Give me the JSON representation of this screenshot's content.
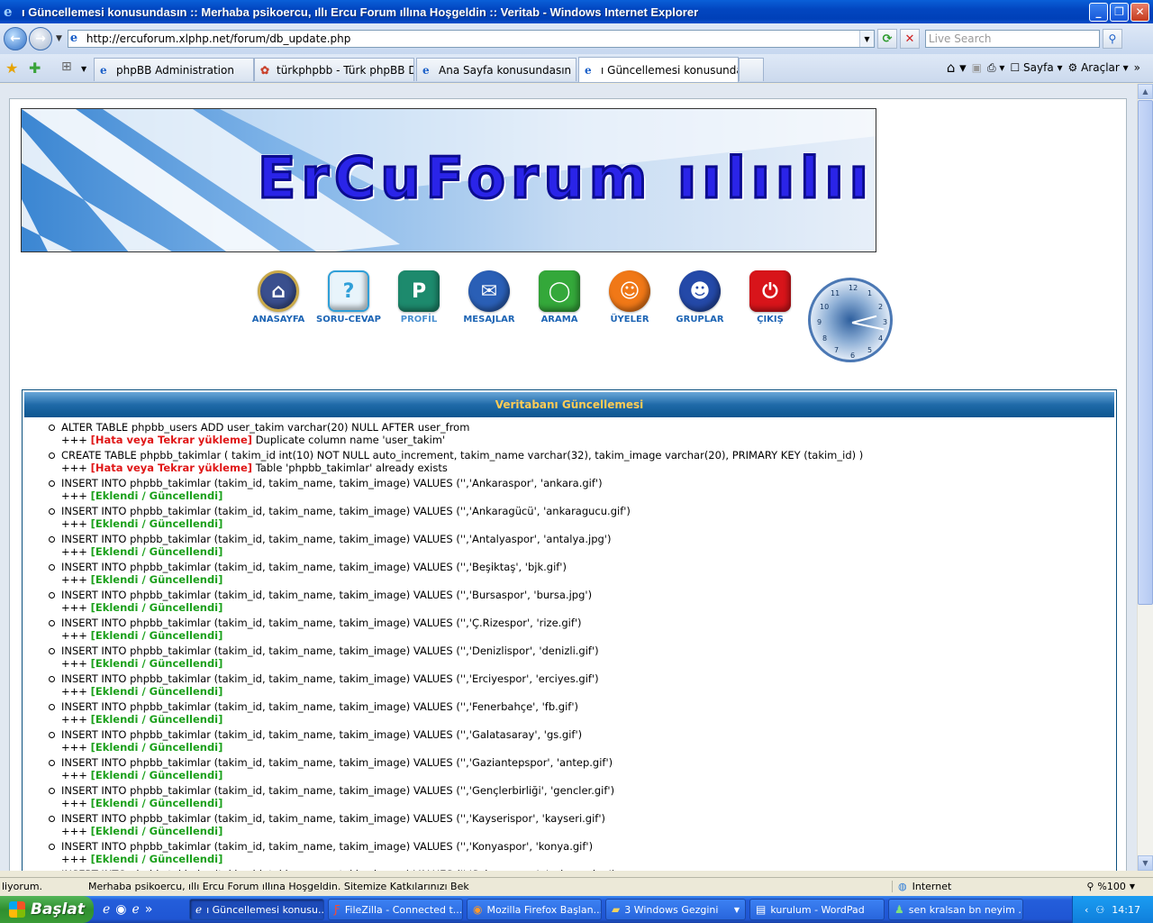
{
  "window": {
    "title": "ı Güncellemesi konusundasın :: Merhaba psikoercu, ıllı Ercu Forum ıllına Hoşgeldin :: Veritab - Windows Internet Explorer"
  },
  "address": {
    "url": "http://ercuforum.xlphp.net/forum/db_update.php",
    "search_placeholder": "Live Search"
  },
  "tabs": [
    {
      "label": "phpBB Administration",
      "active": false
    },
    {
      "label": "türkphpbb - Türk phpBB Dest...",
      "active": false
    },
    {
      "label": "Ana Sayfa konusundasın :: ...",
      "active": false
    },
    {
      "label": "ı Güncellemesi konusunda...",
      "active": true
    }
  ],
  "commandbar": {
    "page_label": "Sayfa",
    "tools_label": "Araçlar"
  },
  "banner": {
    "logo_text": "ErCuForum ıılıılıı"
  },
  "nav": [
    {
      "label": "ANASAYFA",
      "icon": "home-icon",
      "color": "#3a4f8e",
      "glyph": "⌂"
    },
    {
      "label": "SORU-CEVAP",
      "icon": "help-icon",
      "color": "#2f9fd8",
      "glyph": "?"
    },
    {
      "label": "PROFİL",
      "icon": "profile-icon",
      "color": "#1d8a6d",
      "glyph": "P"
    },
    {
      "label": "MESAJLAR",
      "icon": "messages-icon",
      "color": "#2a5fb6",
      "glyph": "✉"
    },
    {
      "label": "ARAMA",
      "icon": "search-icon",
      "color": "#34a83a",
      "glyph": "◯"
    },
    {
      "label": "ÜYELER",
      "icon": "members-icon",
      "color": "#f07817",
      "glyph": "☺"
    },
    {
      "label": "GRUPLAR",
      "icon": "groups-icon",
      "color": "#2449a8",
      "glyph": "☻"
    },
    {
      "label": "ÇIKIŞ",
      "icon": "logout-icon",
      "color": "#d8141a",
      "glyph": "⏻"
    }
  ],
  "clock": {
    "numbers": [
      "12",
      "1",
      "2",
      "3",
      "4",
      "5",
      "6",
      "7",
      "8",
      "9",
      "10",
      "11"
    ]
  },
  "panel": {
    "title": "Veritabanı Güncellemesi",
    "entries": [
      {
        "query": "ALTER TABLE phpbb_users ADD user_takim varchar(20) NULL AFTER user_from",
        "status": "[Hata veya Tekrar yükleme]",
        "type": "err",
        "detail": "Duplicate column name 'user_takim'"
      },
      {
        "query": "CREATE TABLE phpbb_takimlar ( takim_id int(10) NOT NULL auto_increment, takim_name varchar(32), takim_image varchar(20), PRIMARY KEY (takim_id) )",
        "status": "[Hata veya Tekrar yükleme]",
        "type": "err",
        "detail": "Table 'phpbb_takimlar' already exists"
      },
      {
        "query": "INSERT INTO phpbb_takimlar (takim_id, takim_name, takim_image) VALUES ('','Ankaraspor', 'ankara.gif')",
        "status": "[Eklendi / Güncellendi]",
        "type": "ok",
        "detail": ""
      },
      {
        "query": "INSERT INTO phpbb_takimlar (takim_id, takim_name, takim_image) VALUES ('','Ankaragücü', 'ankaragucu.gif')",
        "status": "[Eklendi / Güncellendi]",
        "type": "ok",
        "detail": ""
      },
      {
        "query": "INSERT INTO phpbb_takimlar (takim_id, takim_name, takim_image) VALUES ('','Antalyaspor', 'antalya.jpg')",
        "status": "[Eklendi / Güncellendi]",
        "type": "ok",
        "detail": ""
      },
      {
        "query": "INSERT INTO phpbb_takimlar (takim_id, takim_name, takim_image) VALUES ('','Beşiktaş', 'bjk.gif')",
        "status": "[Eklendi / Güncellendi]",
        "type": "ok",
        "detail": ""
      },
      {
        "query": "INSERT INTO phpbb_takimlar (takim_id, takim_name, takim_image) VALUES ('','Bursaspor', 'bursa.jpg')",
        "status": "[Eklendi / Güncellendi]",
        "type": "ok",
        "detail": ""
      },
      {
        "query": "INSERT INTO phpbb_takimlar (takim_id, takim_name, takim_image) VALUES ('','Ç.Rizespor', 'rize.gif')",
        "status": "[Eklendi / Güncellendi]",
        "type": "ok",
        "detail": ""
      },
      {
        "query": "INSERT INTO phpbb_takimlar (takim_id, takim_name, takim_image) VALUES ('','Denizlispor', 'denizli.gif')",
        "status": "[Eklendi / Güncellendi]",
        "type": "ok",
        "detail": ""
      },
      {
        "query": "INSERT INTO phpbb_takimlar (takim_id, takim_name, takim_image) VALUES ('','Erciyespor', 'erciyes.gif')",
        "status": "[Eklendi / Güncellendi]",
        "type": "ok",
        "detail": ""
      },
      {
        "query": "INSERT INTO phpbb_takimlar (takim_id, takim_name, takim_image) VALUES ('','Fenerbahçe', 'fb.gif')",
        "status": "[Eklendi / Güncellendi]",
        "type": "ok",
        "detail": ""
      },
      {
        "query": "INSERT INTO phpbb_takimlar (takim_id, takim_name, takim_image) VALUES ('','Galatasaray', 'gs.gif')",
        "status": "[Eklendi / Güncellendi]",
        "type": "ok",
        "detail": ""
      },
      {
        "query": "INSERT INTO phpbb_takimlar (takim_id, takim_name, takim_image) VALUES ('','Gaziantepspor', 'antep.gif')",
        "status": "[Eklendi / Güncellendi]",
        "type": "ok",
        "detail": ""
      },
      {
        "query": "INSERT INTO phpbb_takimlar (takim_id, takim_name, takim_image) VALUES ('','Gençlerbirliği', 'gencler.gif')",
        "status": "[Eklendi / Güncellendi]",
        "type": "ok",
        "detail": ""
      },
      {
        "query": "INSERT INTO phpbb_takimlar (takim_id, takim_name, takim_image) VALUES ('','Kayserispor', 'kayseri.gif')",
        "status": "[Eklendi / Güncellendi]",
        "type": "ok",
        "detail": ""
      },
      {
        "query": "INSERT INTO phpbb_takimlar (takim_id, takim_name, takim_image) VALUES ('','Konyaspor', 'konya.gif')",
        "status": "[Eklendi / Güncellendi]",
        "type": "ok",
        "detail": ""
      },
      {
        "query": "INSERT INTO phpbb_takimlar (takim_id, takim_name, takim_image) VALUES ('','Sakaryaspor', 'sakarya.jpg')",
        "status": "",
        "type": "ok",
        "detail": ""
      }
    ]
  },
  "status": {
    "left": "liyorum.",
    "message": "Merhaba  psikoercu, ıllı Ercu Forum ıllına Hoşgeldin. Sitemize Katkılarınızı Bek",
    "zone": "Internet",
    "zoom": "%100"
  },
  "taskbar": {
    "start_label": "Başlat",
    "tasks": [
      {
        "label": "ı Güncellemesi konusu...",
        "icon": "ie-icon",
        "active": true
      },
      {
        "label": "FileZilla - Connected t...",
        "icon": "filezilla-icon",
        "active": false
      },
      {
        "label": "Mozilla Firefox Başlan...",
        "icon": "firefox-icon",
        "active": false
      },
      {
        "label": "3 Windows Gezgini",
        "icon": "folder-icon",
        "active": false
      },
      {
        "label": "kurulum - WordPad",
        "icon": "wordpad-icon",
        "active": false
      },
      {
        "label": "sen kralsan bn neyim ...",
        "icon": "messenger-icon",
        "active": false
      }
    ],
    "clock": "14:17"
  }
}
